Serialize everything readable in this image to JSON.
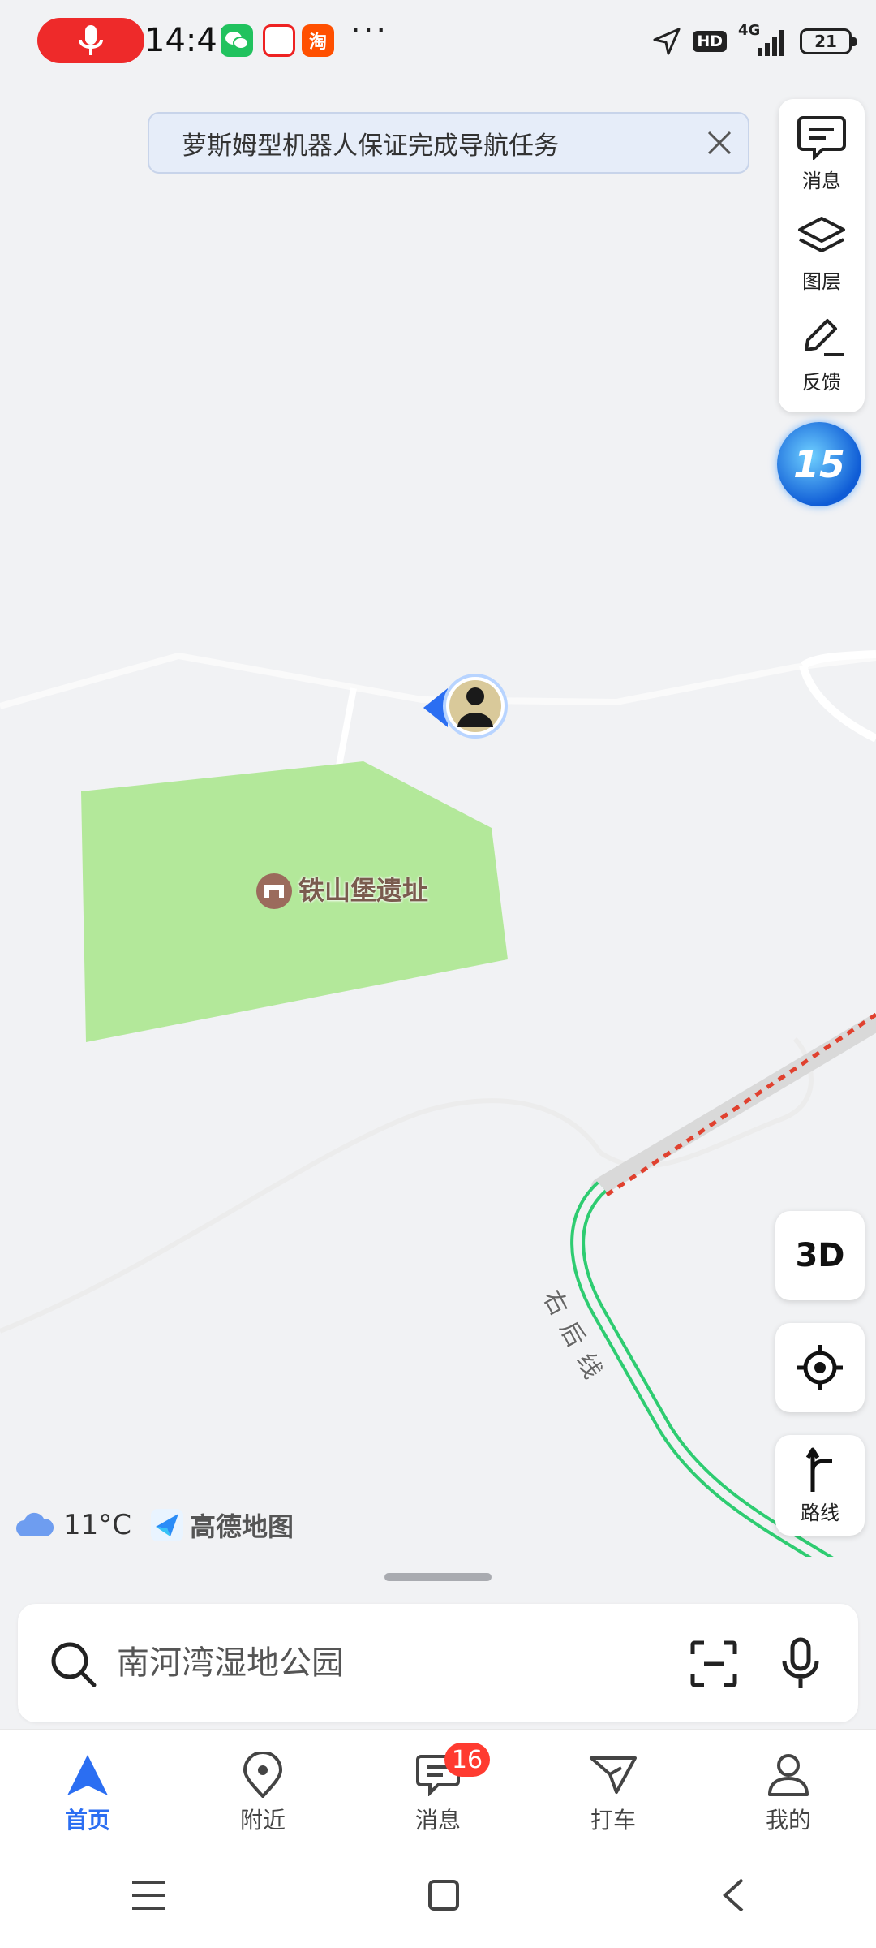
{
  "status_bar": {
    "time": "14:41",
    "more": "···",
    "network": "4G",
    "hd": "HD",
    "battery": "21",
    "apps": [
      "wechat-icon",
      "app-red-icon",
      "taobao-icon"
    ],
    "app_glyphs": [
      "",
      "",
      "淘"
    ]
  },
  "notice": {
    "text": "萝斯姆型机器人保证完成导航任务"
  },
  "right_tools": [
    {
      "label": "消息",
      "icon": "message-icon"
    },
    {
      "label": "图层",
      "icon": "layers-icon"
    },
    {
      "label": "反馈",
      "icon": "feedback-edit-icon"
    }
  ],
  "badge": {
    "text": "15"
  },
  "map": {
    "poi_name": "铁山堡遗址",
    "road_name": "右后线",
    "colors": {
      "park": "#b3e89a",
      "route": "#2ecc71",
      "trail": "#e0412f",
      "road": "#ffffff"
    }
  },
  "map_controls": {
    "three_d": "3D",
    "route_label": "路线"
  },
  "weather": {
    "temp": "11°C"
  },
  "brand": {
    "name": "高德地图"
  },
  "search": {
    "placeholder": "南河湾湿地公园"
  },
  "tabs": [
    {
      "label": "首页",
      "icon": "home-arrow-icon",
      "active": true
    },
    {
      "label": "附近",
      "icon": "location-pin-icon"
    },
    {
      "label": "消息",
      "icon": "chat-icon",
      "badge": "16"
    },
    {
      "label": "打车",
      "icon": "taxi-icon"
    },
    {
      "label": "我的",
      "icon": "profile-icon"
    }
  ],
  "accent": "#2b6ef2"
}
